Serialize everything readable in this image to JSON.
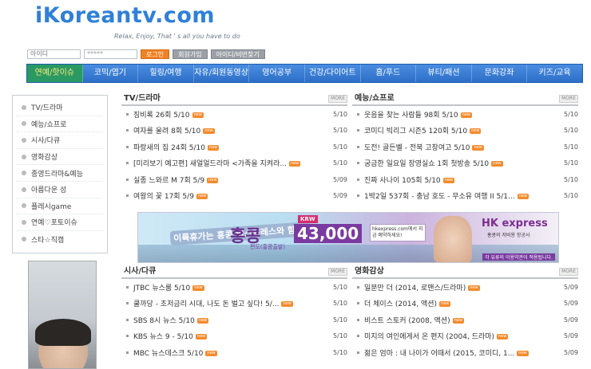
{
  "header": {
    "logo": "iKoreantv.com",
    "tagline": "Relax, Enjoy, That ' s all you have to do"
  },
  "login": {
    "id_placeholder": "아이디",
    "password_value": "*****",
    "login_label": "로그인",
    "signup_label": "회원가입",
    "find_label": "아이디/비번찾기"
  },
  "nav": [
    {
      "label": "연예/핫이슈",
      "active": true
    },
    {
      "label": "코믹/엽기"
    },
    {
      "label": "힐링/여행"
    },
    {
      "label": "자유/회원동영상"
    },
    {
      "label": "영어공부"
    },
    {
      "label": "건강/다이어트"
    },
    {
      "label": "홈/푸드"
    },
    {
      "label": "뷰티/패션"
    },
    {
      "label": "문화강좌"
    },
    {
      "label": "키즈/교육"
    }
  ],
  "sidebar": [
    {
      "label": "TV/드라마"
    },
    {
      "label": "예능/쇼프로"
    },
    {
      "label": "시사/다큐"
    },
    {
      "label": "영화감상"
    },
    {
      "label": "종영드라마&예능"
    },
    {
      "label": "아름다운 성"
    },
    {
      "label": "플레시game"
    },
    {
      "label": "연예♡포토이슈"
    },
    {
      "label": "스타☆직캠"
    }
  ],
  "sections": {
    "tv": {
      "title": "TV/드라마",
      "more": "MORE",
      "rows": [
        {
          "text": "징비록 26회 5/10",
          "date": "5/10",
          "new": true
        },
        {
          "text": "여자를 울려 8회 5/10",
          "date": "5/10",
          "new": true
        },
        {
          "text": "파랑새의 집 24회 5/10",
          "date": "5/10",
          "new": true
        },
        {
          "text": "[미리보기 예고편] 새얼얼드라마 <가족을 지켜라...",
          "date": "5/10",
          "new": true
        },
        {
          "text": "실종 느와르 M 7회 5/9",
          "date": "5/09",
          "new": true
        },
        {
          "text": "여왕의 꽃 17회 5/9",
          "date": "5/09",
          "new": true
        }
      ]
    },
    "variety": {
      "title": "예능/쇼프로",
      "more": "MORE",
      "rows": [
        {
          "text": "웃음을 찾는 사람들 98회 5/10",
          "date": "5/10",
          "new": true
        },
        {
          "text": "코미디 빅리그 시즌5 120회 5/10",
          "date": "5/10",
          "new": true
        },
        {
          "text": "도전! 골든벨 - 전북 고창여고 5/10",
          "date": "5/10",
          "new": true
        },
        {
          "text": "궁금한 일요일 장영실쇼 1회 첫방송 5/10",
          "date": "5/10",
          "new": true
        },
        {
          "text": "진짜 사나이 105회 5/10",
          "date": "5/10",
          "new": true
        },
        {
          "text": "1박2일 537회 - 충남 호도 - 무소유 여행 II 5/1...",
          "date": "5/10",
          "new": true
        }
      ]
    },
    "docu": {
      "title": "시사/다큐",
      "more": "MORE",
      "rows": [
        {
          "text": "JTBC 뉴스룸 5/10",
          "date": "5/10",
          "new": true
        },
        {
          "text": "쿨까당 - 초저금리 시대, 나도 돈 벌고 싶다! 5/...",
          "date": "5/10",
          "new": true
        },
        {
          "text": "SBS 8시 뉴스 5/10",
          "date": "5/10",
          "new": true
        },
        {
          "text": "KBS 뉴스 9 - 5/10",
          "date": "5/10",
          "new": true
        },
        {
          "text": "MBC 뉴스데스크 5/10",
          "date": "5/10",
          "new": true
        }
      ]
    },
    "movie": {
      "title": "영화감상",
      "more": "MORE",
      "rows": [
        {
          "text": "일분만 더 (2014, 로맨스/드라마)",
          "date": "5/09",
          "new": true
        },
        {
          "text": "더 체이스 (2014, 액션)",
          "date": "5/09",
          "new": true
        },
        {
          "text": "비스트 스토커 (2008, 액션)",
          "date": "5/09",
          "new": true
        },
        {
          "text": "미지의 여인에게서 온 편지 (2004, 드라마)",
          "date": "5/09",
          "new": true
        },
        {
          "text": "젊은 엄마 : 내 나이가 어때서 (2015, 코미디, 1...",
          "date": "5/09",
          "new": true
        }
      ]
    }
  },
  "banner": {
    "msg": "이륙휴가는 홍콩 익스프레스와 함께!",
    "city": "홍콩",
    "route": "편도(홍콩출발)",
    "krw": "KRW",
    "price": "43,000",
    "site": "hkexpress.com에서 지금 예약하세요!",
    "brand": "HK express",
    "brand_sub": "홍콩의 저비용 항공사",
    "foot": "각 유류의 이용약관이 적용됩니다."
  }
}
